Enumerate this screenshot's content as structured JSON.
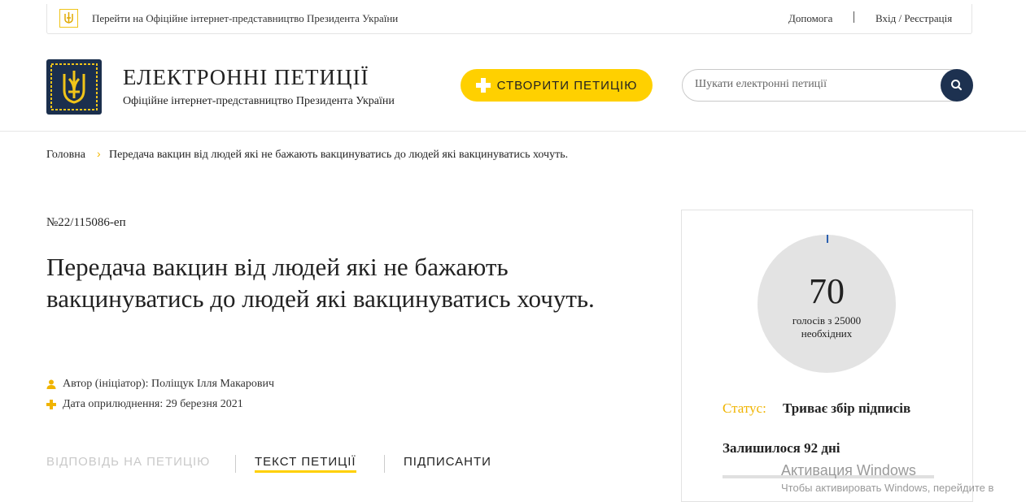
{
  "topbar": {
    "official_link": "Перейти на Офіційне інтернет-представництво Президента України",
    "help": "Допомога",
    "login": "Вхід / Реєстрація"
  },
  "header": {
    "title": "ЕЛЕКТРОННІ ПЕТИЦІЇ",
    "subtitle": "Офіційне інтернет-представництво Президента України",
    "create_button": "СТВОРИТИ ПЕТИЦІЮ",
    "search_placeholder": "Шукати електронні петиції",
    "icons": {
      "logo": "trident-emblem-icon",
      "search": "search-icon",
      "create": "plus-icon"
    }
  },
  "breadcrumb": {
    "home": "Головна",
    "separator": "›",
    "current": "Передача вакцин від людей які не бажають вакцинуватись до людей які вакцинуватись хочуть."
  },
  "petition": {
    "number": "№22/115086-еп",
    "title": "Передача вакцин від людей які не бажають вакцинуватись до людей які вакцинуватись хочуть.",
    "author": "Автор (ініціатор): Поліщук Ілля Макарович",
    "published": "Дата оприлюднення: 29 березня 2021"
  },
  "tabs": [
    {
      "label": "ВІДПОВІДЬ НА ПЕТИЦІЮ",
      "state": "disabled"
    },
    {
      "label": "ТЕКСТ ПЕТИЦІЇ",
      "state": "active"
    },
    {
      "label": "ПІДПИСАНТИ",
      "state": "normal"
    }
  ],
  "sidebar": {
    "votes": "70",
    "votes_sub": "голосів з 25000 необхідних",
    "votes_progress_fraction": 0.0028,
    "status_label": "Статус:",
    "status_value": "Триває збір підписів",
    "days_left": "Залишилося 92 дні"
  },
  "colors": {
    "accent": "#ffd000",
    "navy": "#1d3150",
    "status": "#f0b400"
  },
  "overlay": {
    "activation_title": "Активация Windows",
    "activation_text": "Чтобы активировать Windows, перейдите в"
  }
}
